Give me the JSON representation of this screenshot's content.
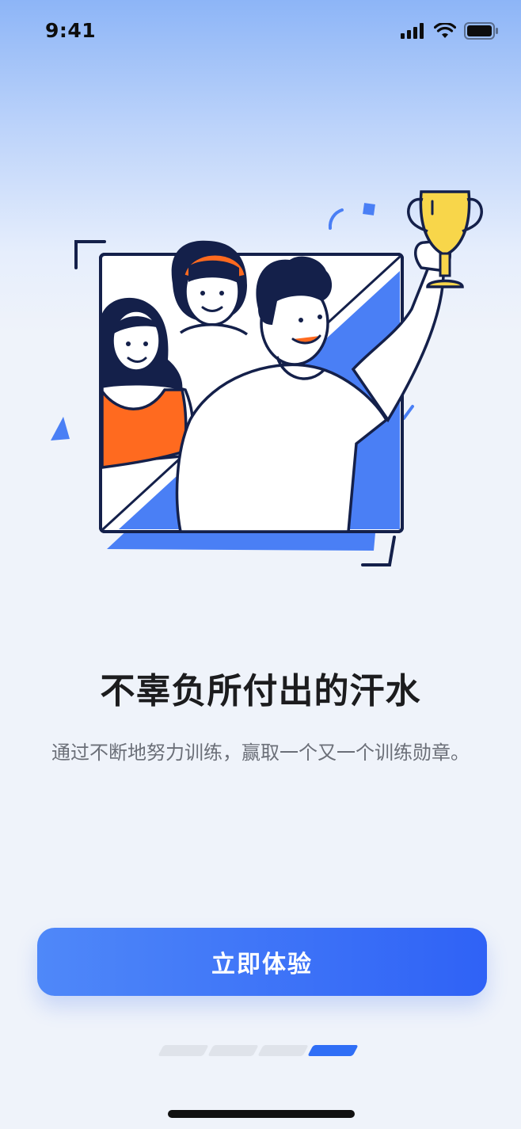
{
  "status_bar": {
    "time": "9:41"
  },
  "onboarding": {
    "title": "不辜负所付出的汗水",
    "subtitle": "通过不断地努力训练，赢取一个又一个训练勋章。",
    "cta_label": "立即体验",
    "pager": {
      "total": 4,
      "active_index": 3
    }
  },
  "colors": {
    "accent": "#2f6ef6",
    "illustration_blue": "#4a7ff5",
    "trophy": "#f8d64a",
    "shirt_orange": "#ff6a1f",
    "outline": "#14204a"
  },
  "icons": [
    "cellular-signal-icon",
    "wifi-icon",
    "battery-icon"
  ]
}
